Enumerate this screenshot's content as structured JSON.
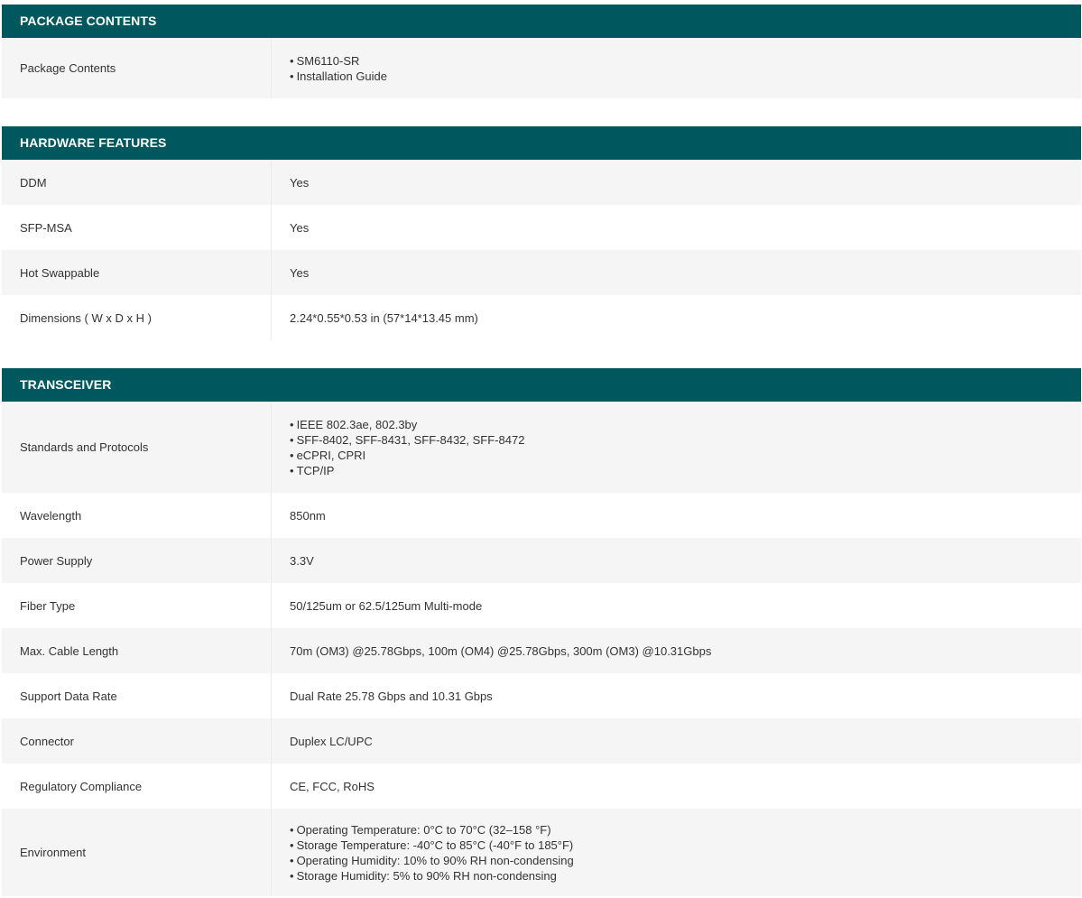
{
  "sections": [
    {
      "title": "PACKAGE CONTENTS",
      "rows": [
        {
          "label": "Package Contents",
          "items": [
            "SM6110-SR",
            "Installation Guide"
          ]
        }
      ]
    },
    {
      "title": "HARDWARE FEATURES",
      "rows": [
        {
          "label": "DDM",
          "value": "Yes"
        },
        {
          "label": "SFP-MSA",
          "value": "Yes"
        },
        {
          "label": "Hot Swappable",
          "value": "Yes"
        },
        {
          "label": "Dimensions ( W x D x H )",
          "value": "2.24*0.55*0.53 in (57*14*13.45 mm)"
        }
      ]
    },
    {
      "title": "TRANSCEIVER",
      "rows": [
        {
          "label": "Standards and Protocols",
          "items": [
            "IEEE 802.3ae, 802.3by",
            "SFF-8402, SFF-8431, SFF-8432, SFF-8472",
            "eCPRI, CPRI",
            "TCP/IP"
          ]
        },
        {
          "label": "Wavelength",
          "value": "850nm"
        },
        {
          "label": "Power Supply",
          "value": "3.3V"
        },
        {
          "label": "Fiber Type",
          "value": "50/125um or 62.5/125um Multi-mode"
        },
        {
          "label": "Max. Cable Length",
          "value": "70m (OM3) @25.78Gbps, 100m (OM4) @25.78Gbps, 300m (OM3) @10.31Gbps"
        },
        {
          "label": "Support Data Rate",
          "value": "Dual Rate 25.78 Gbps and 10.31 Gbps"
        },
        {
          "label": "Connector",
          "value": "Duplex LC/UPC"
        },
        {
          "label": "Regulatory Compliance",
          "value": "CE, FCC, RoHS"
        },
        {
          "label": "Environment",
          "items": [
            "Operating Temperature: 0°C to 70°C (32–158 °F)",
            "Storage Temperature: -40°C to 85°C (-40°F to 185°F)",
            "Operating Humidity: 10% to 90% RH non-condensing",
            "Storage Humidity: 5% to 90% RH non-condensing"
          ]
        }
      ]
    }
  ],
  "colors": {
    "header_bg": "#00585f",
    "header_text": "#ffffff",
    "row_alt_bg": "#f5f5f5",
    "text": "#333333"
  }
}
